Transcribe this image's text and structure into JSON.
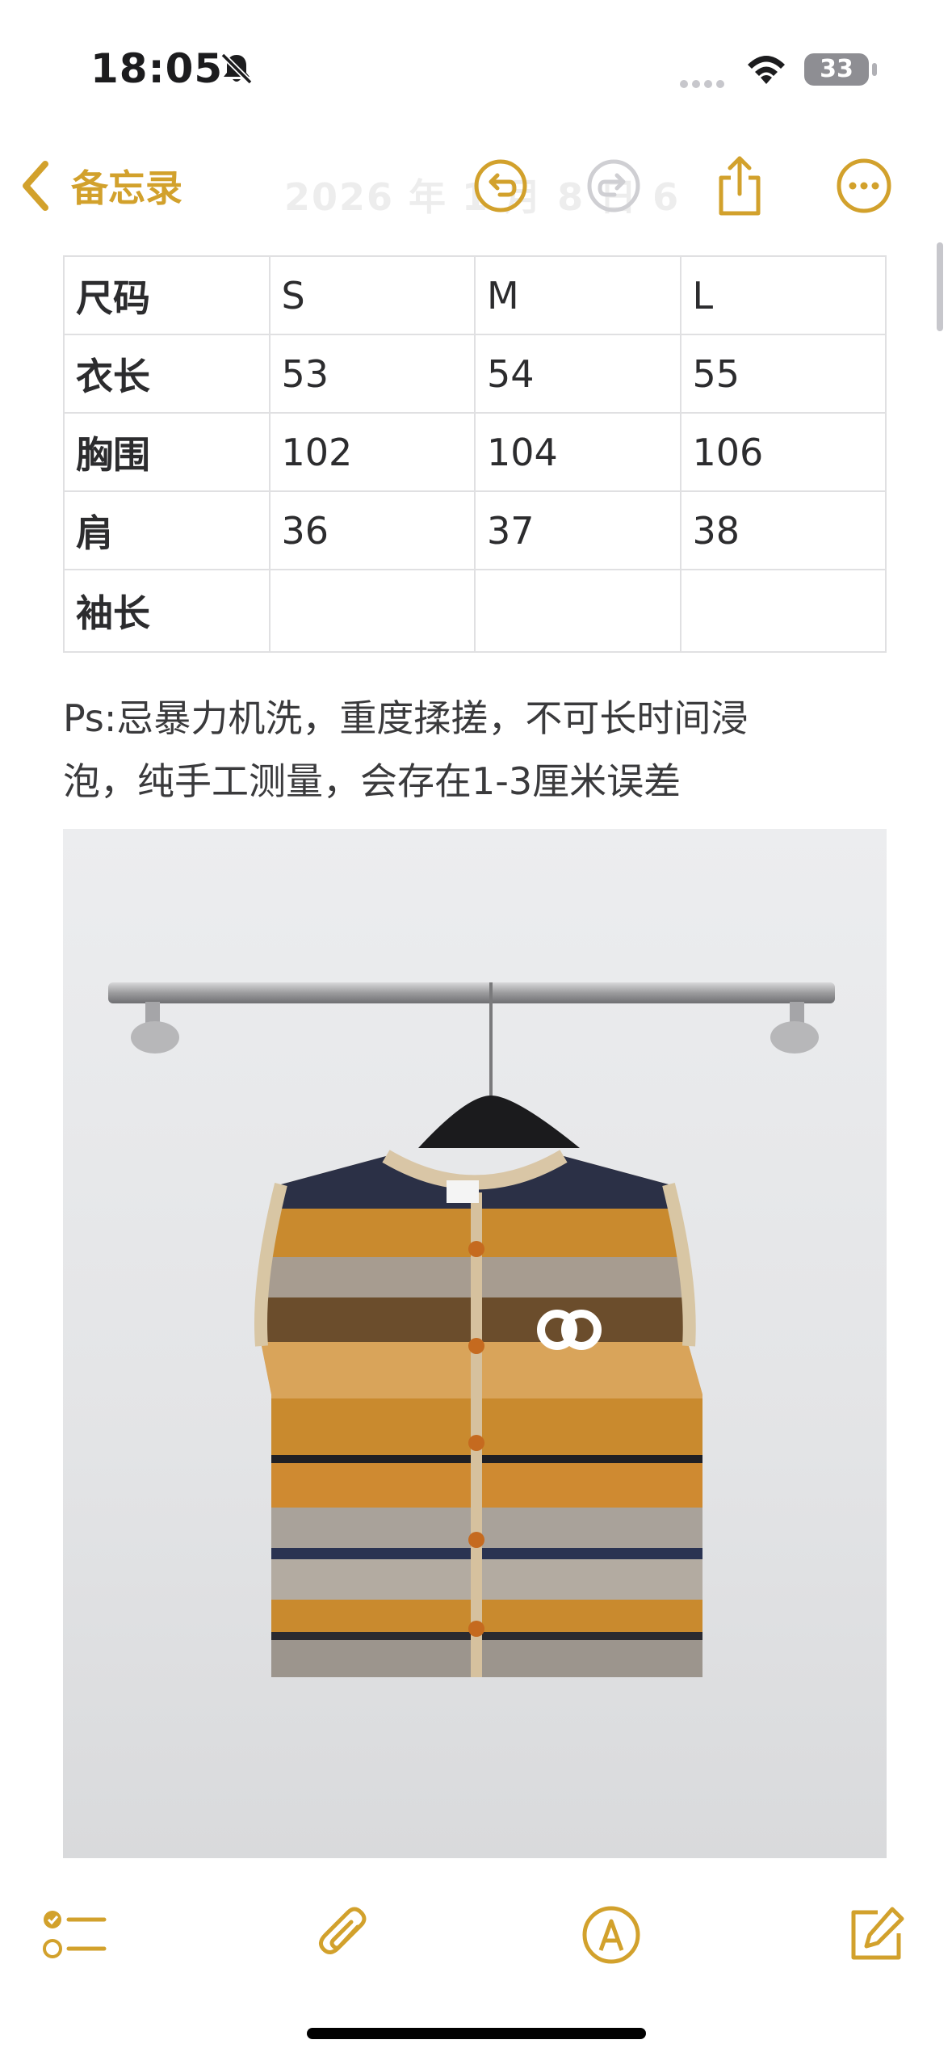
{
  "status_bar": {
    "time": "18:05",
    "battery": "33",
    "icons": [
      "bell-slash-icon",
      "cellular-signal-icon",
      "wifi-icon",
      "battery-icon"
    ]
  },
  "nav": {
    "back_label": "备忘录",
    "faded_title": "2026 年 1 月 8 日 6",
    "accent_color": "#d2a12c",
    "icons": [
      "chevron-left-icon",
      "undo-icon",
      "redo-icon",
      "share-icon",
      "more-icon"
    ]
  },
  "table": {
    "rows": [
      [
        "尺码",
        "S",
        "M",
        "L"
      ],
      [
        "衣长",
        "53",
        "54",
        "55"
      ],
      [
        "胸围",
        "102",
        "104",
        "106"
      ],
      [
        "肩",
        "36",
        "37",
        "38"
      ],
      [
        "袖长",
        "",
        "",
        ""
      ]
    ]
  },
  "note": {
    "line1": "Ps:忌暴力机洗，重度揉搓，不可长时间浸",
    "line2": "泡，纯手工测量，会存在1-3厘米误差"
  },
  "toolbar": {
    "icons": [
      "checklist-icon",
      "paperclip-icon",
      "markup-pen-icon",
      "compose-icon"
    ]
  }
}
